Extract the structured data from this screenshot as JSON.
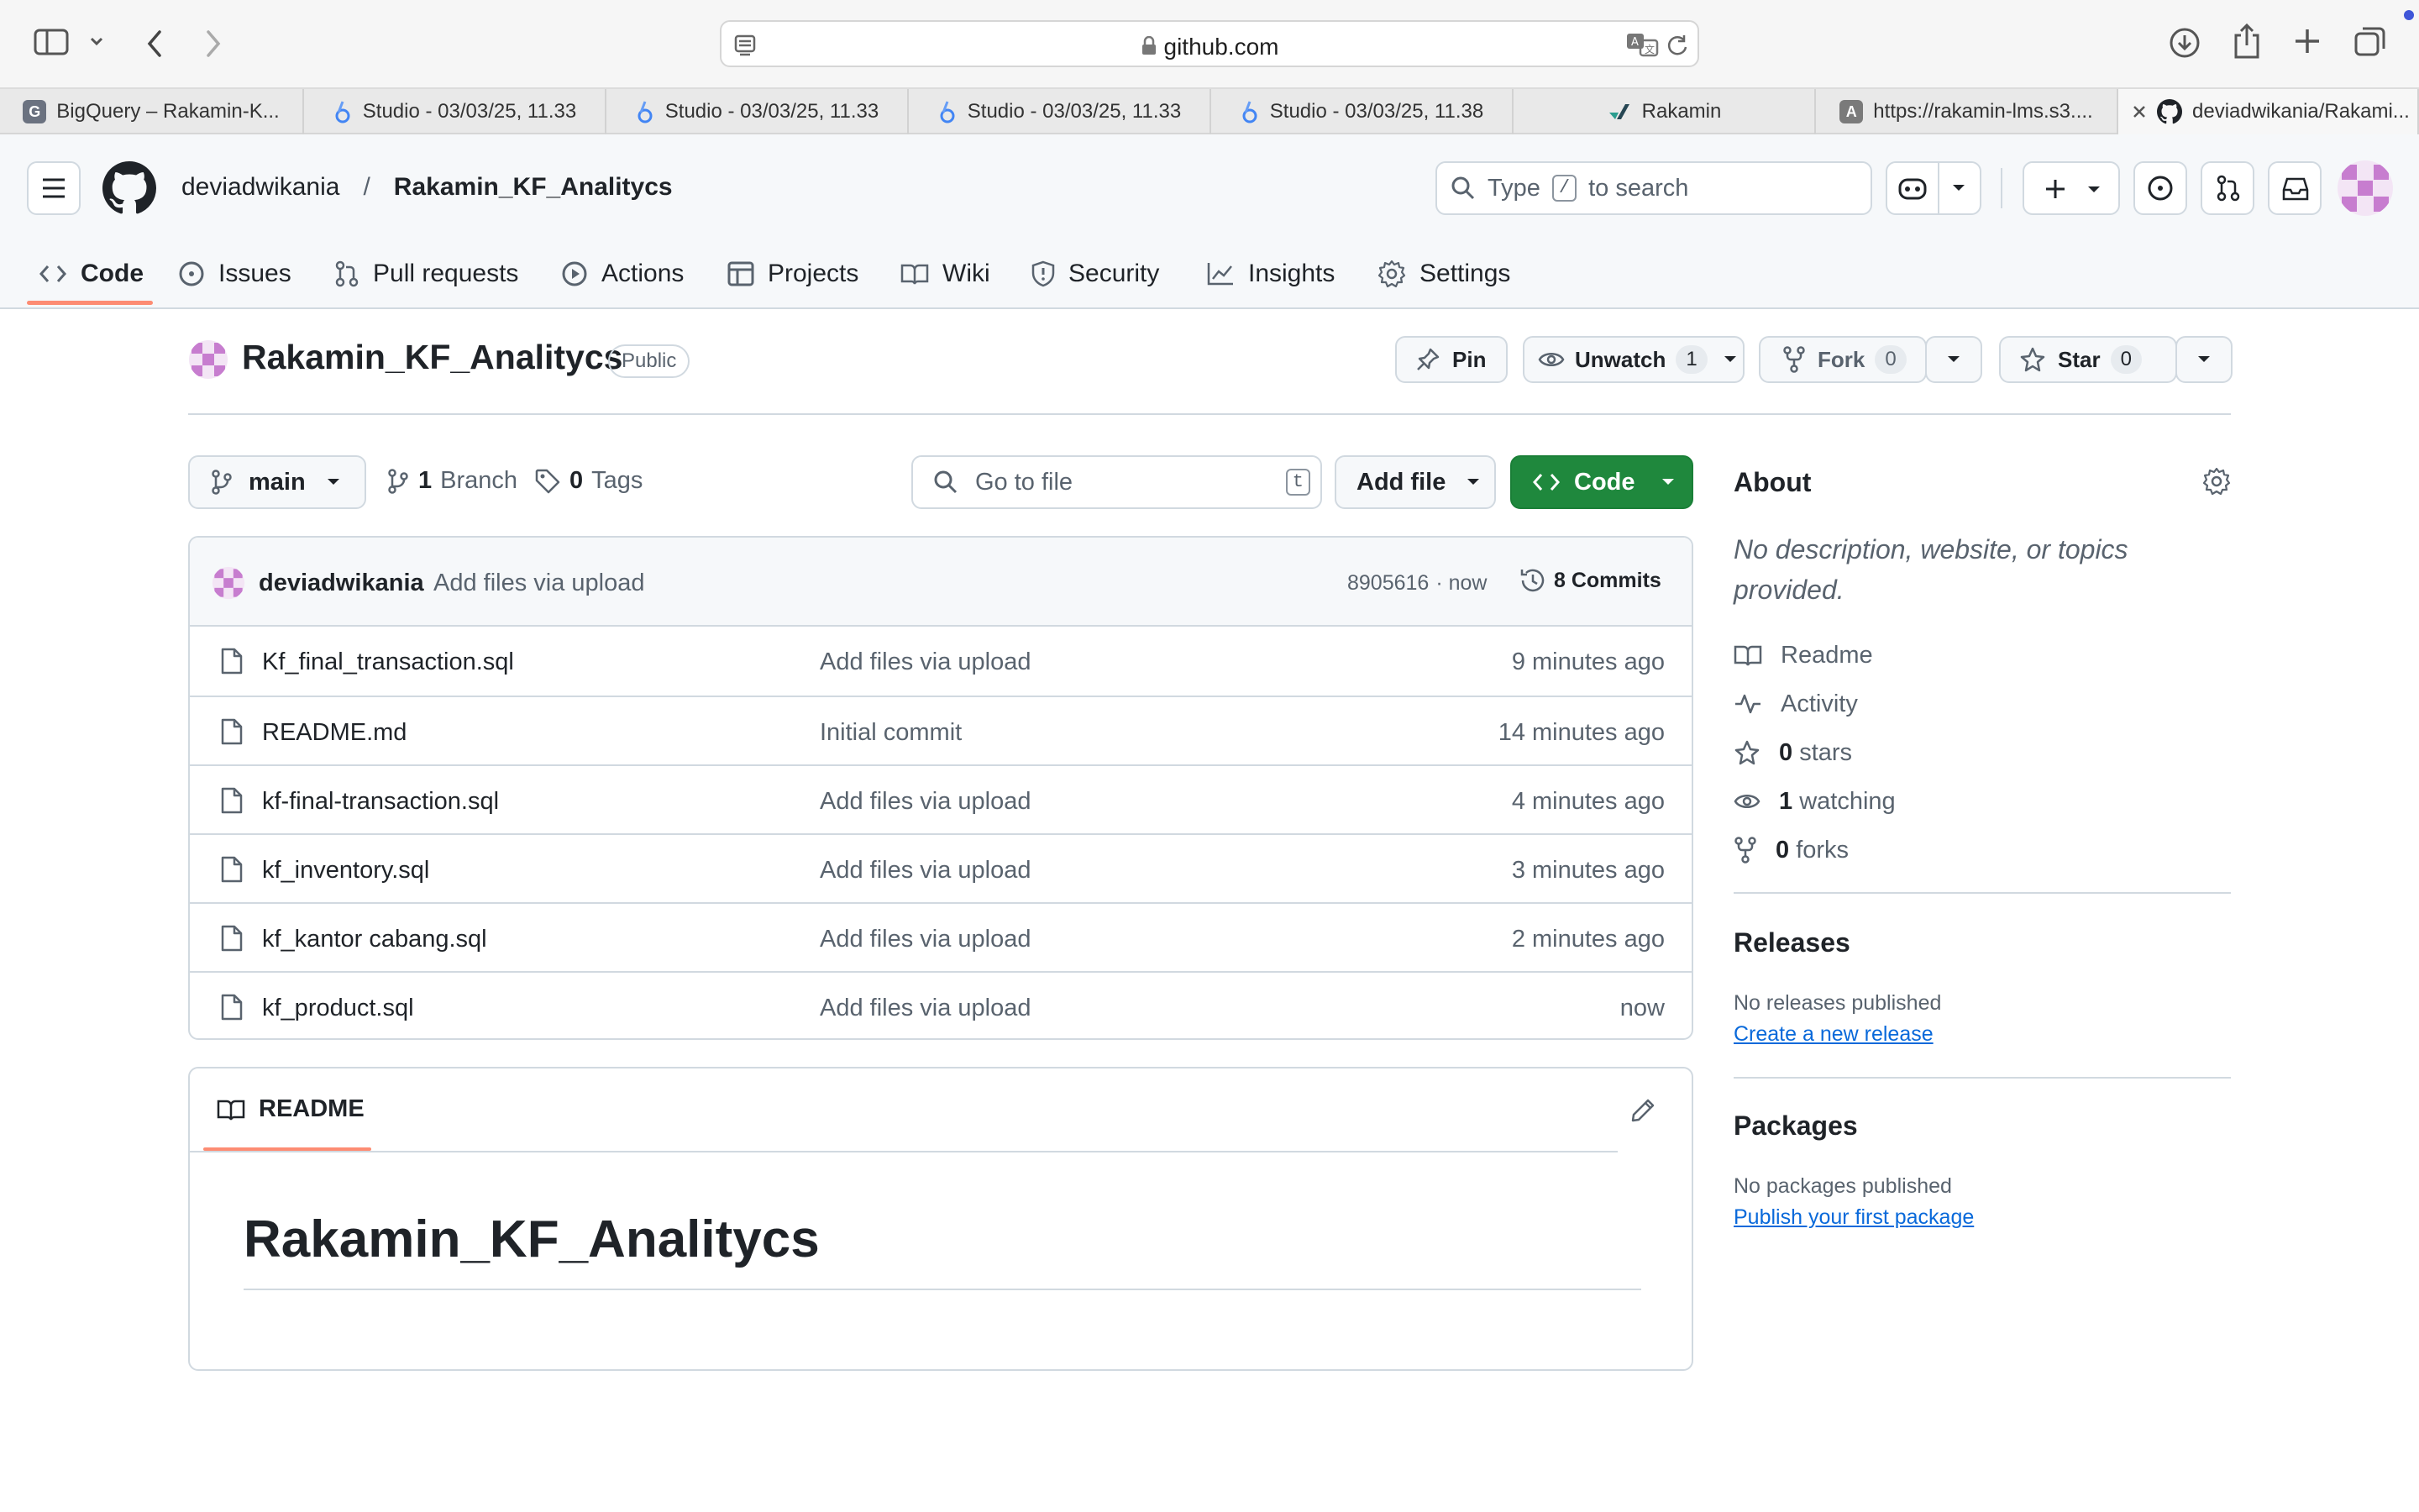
{
  "browser": {
    "url": "github.com",
    "tabs": [
      {
        "label": "BigQuery – Rakamin-K...",
        "favicon": "G"
      },
      {
        "label": "Studio - 03/03/25, 11.33",
        "favicon": "studio-icon"
      },
      {
        "label": "Studio - 03/03/25, 11.33",
        "favicon": "studio-icon"
      },
      {
        "label": "Studio - 03/03/25, 11.33",
        "favicon": "studio-icon"
      },
      {
        "label": "Studio - 03/03/25, 11.38",
        "favicon": "studio-icon"
      },
      {
        "label": "Rakamin",
        "favicon": "rakamin-icon"
      },
      {
        "label": "https://rakamin-lms.s3....",
        "favicon": "A"
      },
      {
        "label": "deviadwikania/Rakami...",
        "favicon": "github-icon"
      }
    ]
  },
  "header": {
    "owner": "deviadwikania",
    "separator": "/",
    "repo": "Rakamin_KF_Analitycs",
    "search_prefix": "Type",
    "search_key": "/",
    "search_suffix": "to search"
  },
  "nav": {
    "tabs": [
      {
        "label": "Code",
        "icon": "code-icon"
      },
      {
        "label": "Issues",
        "icon": "issue-icon"
      },
      {
        "label": "Pull requests",
        "icon": "pull-request-icon"
      },
      {
        "label": "Actions",
        "icon": "play-icon"
      },
      {
        "label": "Projects",
        "icon": "table-icon"
      },
      {
        "label": "Wiki",
        "icon": "book-icon"
      },
      {
        "label": "Security",
        "icon": "shield-icon"
      },
      {
        "label": "Insights",
        "icon": "graph-icon"
      },
      {
        "label": "Settings",
        "icon": "gear-icon"
      }
    ]
  },
  "repo": {
    "name": "Rakamin_KF_Analitycs",
    "visibility": "Public",
    "pin_label": "Pin",
    "unwatch_label": "Unwatch",
    "watch_count": "1",
    "fork_label": "Fork",
    "fork_count": "0",
    "star_label": "Star",
    "star_count": "0"
  },
  "toolbar": {
    "branch": "main",
    "branch_count": "1",
    "branch_label": "Branch",
    "tag_count": "0",
    "tag_label": "Tags",
    "go_to_file_placeholder": "Go to file",
    "go_to_file_key": "t",
    "add_file_label": "Add file",
    "code_label": "Code"
  },
  "commit": {
    "author": "deviadwikania",
    "message": "Add files via upload",
    "hash": "8905616",
    "time": "· now",
    "commits_label": "8 Commits"
  },
  "files": [
    {
      "name": "Kf_final_transaction.sql",
      "message": "Add files via upload",
      "time": "9 minutes ago"
    },
    {
      "name": "README.md",
      "message": "Initial commit",
      "time": "14 minutes ago"
    },
    {
      "name": "kf-final-transaction.sql",
      "message": "Add files via upload",
      "time": "4 minutes ago"
    },
    {
      "name": "kf_inventory.sql",
      "message": "Add files via upload",
      "time": "3 minutes ago"
    },
    {
      "name": "kf_kantor cabang.sql",
      "message": "Add files via upload",
      "time": "2 minutes ago"
    },
    {
      "name": "kf_product.sql",
      "message": "Add files via upload",
      "time": "now"
    }
  ],
  "readme": {
    "tab_label": "README",
    "heading": "Rakamin_KF_Analitycs"
  },
  "about": {
    "title": "About",
    "description": "No description, website, or topics provided.",
    "readme_label": "Readme",
    "activity_label": "Activity",
    "stars_count": "0",
    "stars_label": "stars",
    "watching_count": "1",
    "watching_label": "watching",
    "forks_count": "0",
    "forks_label": "forks"
  },
  "releases": {
    "title": "Releases",
    "empty_text": "No releases published",
    "create_link": "Create a new release"
  },
  "packages": {
    "title": "Packages",
    "empty_text": "No packages published",
    "publish_link": "Publish your first package"
  },
  "colors": {
    "accent_green": "#1f883d",
    "link_blue": "#0969da",
    "tab_underline": "#fd8c73"
  }
}
